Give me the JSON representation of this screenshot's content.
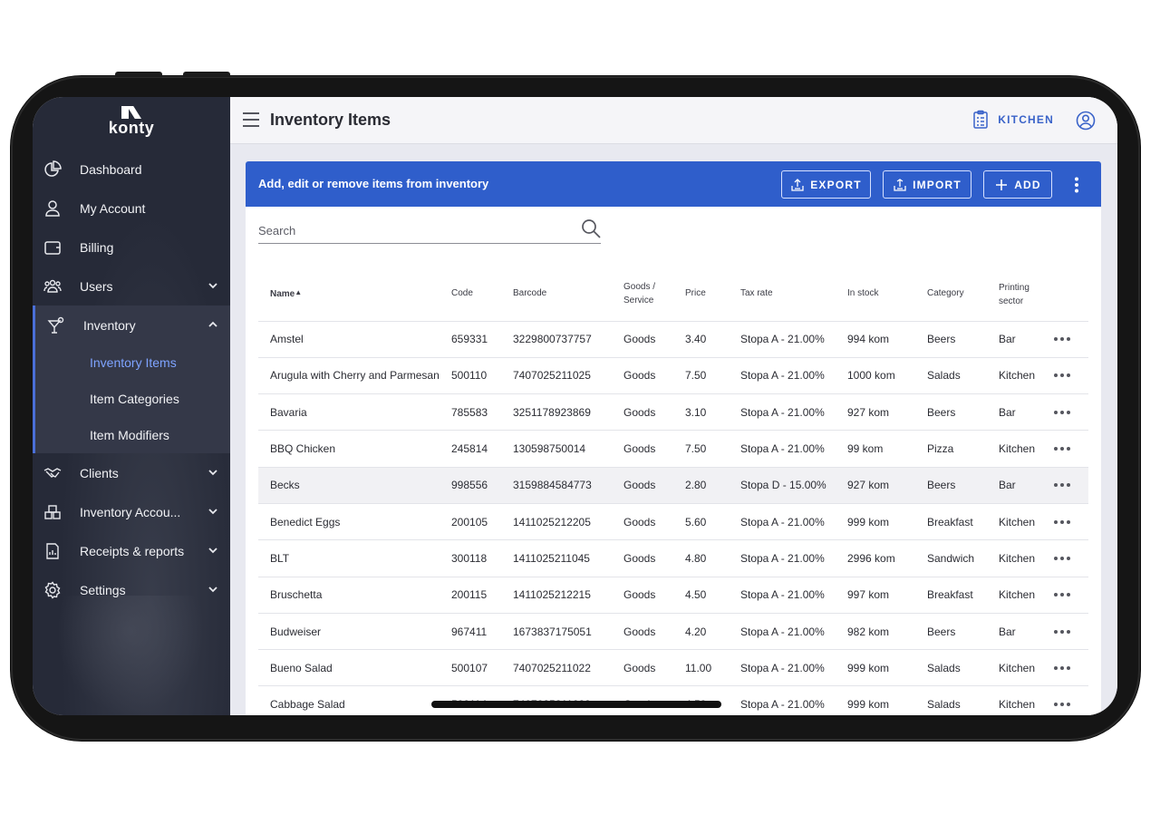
{
  "brand": {
    "logo_text": "konty"
  },
  "sidebar": {
    "items": [
      {
        "label": "Dashboard",
        "icon": "pie-chart-icon"
      },
      {
        "label": "My Account",
        "icon": "person-icon"
      },
      {
        "label": "Billing",
        "icon": "wallet-icon"
      },
      {
        "label": "Users",
        "icon": "users-group-icon"
      },
      {
        "label": "Inventory",
        "icon": "cocktail-icon"
      },
      {
        "label": "Clients",
        "icon": "handshake-icon"
      },
      {
        "label": "Inventory Accou...",
        "icon": "boxes-icon"
      },
      {
        "label": "Receipts & reports",
        "icon": "report-icon"
      },
      {
        "label": "Settings",
        "icon": "gear-icon"
      }
    ],
    "inventory_sub": [
      {
        "label": "Inventory Items"
      },
      {
        "label": "Item Categories"
      },
      {
        "label": "Item Modifiers"
      }
    ]
  },
  "header": {
    "title": "Inventory Items",
    "sector_label": "KITCHEN"
  },
  "card": {
    "subtitle": "Add, edit or remove items from inventory",
    "export_label": "EXPORT",
    "import_label": "IMPORT",
    "add_label": "ADD"
  },
  "search": {
    "placeholder": "Search"
  },
  "table": {
    "columns": {
      "name": "Name",
      "code": "Code",
      "barcode": "Barcode",
      "goods_1": "Goods /",
      "goods_2": "Service",
      "price": "Price",
      "tax": "Tax rate",
      "stock": "In stock",
      "category": "Category",
      "sector_1": "Printing",
      "sector_2": "sector"
    },
    "rows": [
      {
        "name": "Amstel",
        "code": "659331",
        "barcode": "3229800737757",
        "type": "Goods",
        "price": "3.40",
        "tax": "Stopa A - 21.00%",
        "stock": "994 kom",
        "category": "Beers",
        "sector": "Bar"
      },
      {
        "name": "Arugula with Cherry and Parmesan",
        "code": "500110",
        "barcode": "7407025211025",
        "type": "Goods",
        "price": "7.50",
        "tax": "Stopa A - 21.00%",
        "stock": "1000 kom",
        "category": "Salads",
        "sector": "Kitchen"
      },
      {
        "name": "Bavaria",
        "code": "785583",
        "barcode": "3251178923869",
        "type": "Goods",
        "price": "3.10",
        "tax": "Stopa A - 21.00%",
        "stock": "927 kom",
        "category": "Beers",
        "sector": "Bar"
      },
      {
        "name": "BBQ Chicken",
        "code": "245814",
        "barcode": "130598750014",
        "type": "Goods",
        "price": "7.50",
        "tax": "Stopa A - 21.00%",
        "stock": "99 kom",
        "category": "Pizza",
        "sector": "Kitchen"
      },
      {
        "name": "Becks",
        "code": "998556",
        "barcode": "3159884584773",
        "type": "Goods",
        "price": "2.80",
        "tax": "Stopa D - 15.00%",
        "stock": "927 kom",
        "category": "Beers",
        "sector": "Bar"
      },
      {
        "name": "Benedict Eggs",
        "code": "200105",
        "barcode": "1411025212205",
        "type": "Goods",
        "price": "5.60",
        "tax": "Stopa A - 21.00%",
        "stock": "999 kom",
        "category": "Breakfast",
        "sector": "Kitchen"
      },
      {
        "name": "BLT",
        "code": "300118",
        "barcode": "1411025211045",
        "type": "Goods",
        "price": "4.80",
        "tax": "Stopa A - 21.00%",
        "stock": "2996 kom",
        "category": "Sandwich",
        "sector": "Kitchen"
      },
      {
        "name": "Bruschetta",
        "code": "200115",
        "barcode": "1411025212215",
        "type": "Goods",
        "price": "4.50",
        "tax": "Stopa A - 21.00%",
        "stock": "997 kom",
        "category": "Breakfast",
        "sector": "Kitchen"
      },
      {
        "name": "Budweiser",
        "code": "967411",
        "barcode": "1673837175051",
        "type": "Goods",
        "price": "4.20",
        "tax": "Stopa A - 21.00%",
        "stock": "982 kom",
        "category": "Beers",
        "sector": "Bar"
      },
      {
        "name": "Bueno Salad",
        "code": "500107",
        "barcode": "7407025211022",
        "type": "Goods",
        "price": "11.00",
        "tax": "Stopa A - 21.00%",
        "stock": "999 kom",
        "category": "Salads",
        "sector": "Kitchen"
      },
      {
        "name": "Cabbage Salad",
        "code": "500114",
        "barcode": "7407025211029",
        "type": "Goods",
        "price": "4.50",
        "tax": "Stopa A - 21.00%",
        "stock": "999 kom",
        "category": "Salads",
        "sector": "Kitchen"
      }
    ]
  },
  "colors": {
    "accent": "#2f5ecb",
    "sidebar_bg": "#262a38",
    "active_link": "#7ea3ff"
  }
}
